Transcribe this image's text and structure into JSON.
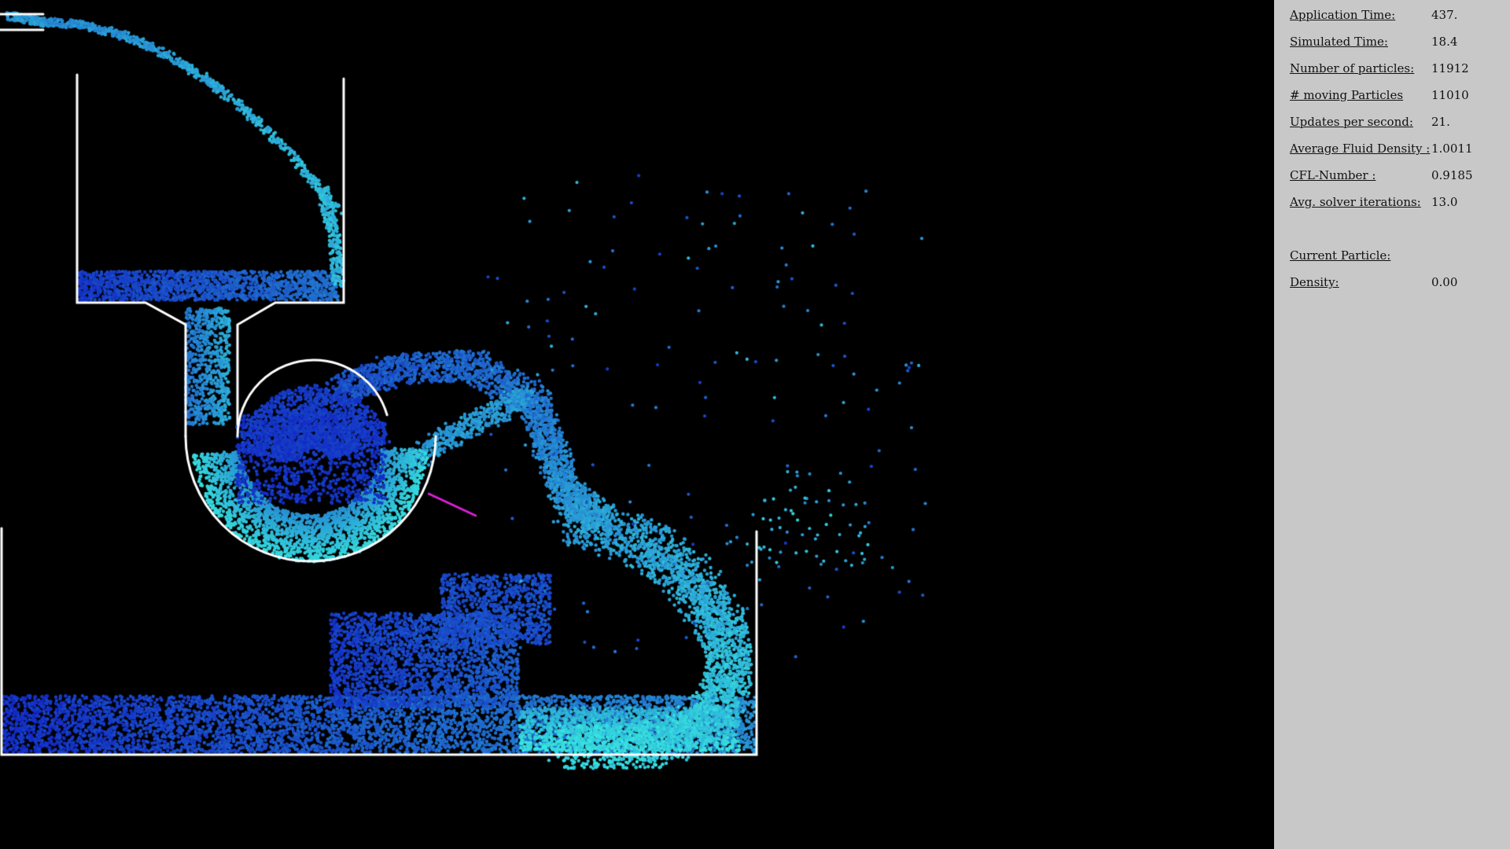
{
  "colors": {
    "background": "#000000",
    "panel": "#c8c8c8",
    "wall": "#ffffff",
    "particle_deep": "#1226c4",
    "particle_fast": "#38e6e0",
    "indicator": "#e020e0"
  },
  "stats": [
    {
      "label": "Application Time:",
      "value": "437."
    },
    {
      "label": "Simulated Time:",
      "value": "18.4"
    },
    {
      "label": "Number of particles:",
      "value": "11912"
    },
    {
      "label": "# moving Particles",
      "value": "11010"
    },
    {
      "label": "Updates per second:",
      "value": "21."
    },
    {
      "label": "Average Fluid Density :",
      "value": "1.0011"
    },
    {
      "label": "CFL-Number :",
      "value": "0.9185"
    },
    {
      "label": "Avg. solver iterations:",
      "value": "13.0"
    }
  ],
  "current_particle": {
    "label": "Current Particle:",
    "density_label": "Density:",
    "density_value": "0.00"
  }
}
